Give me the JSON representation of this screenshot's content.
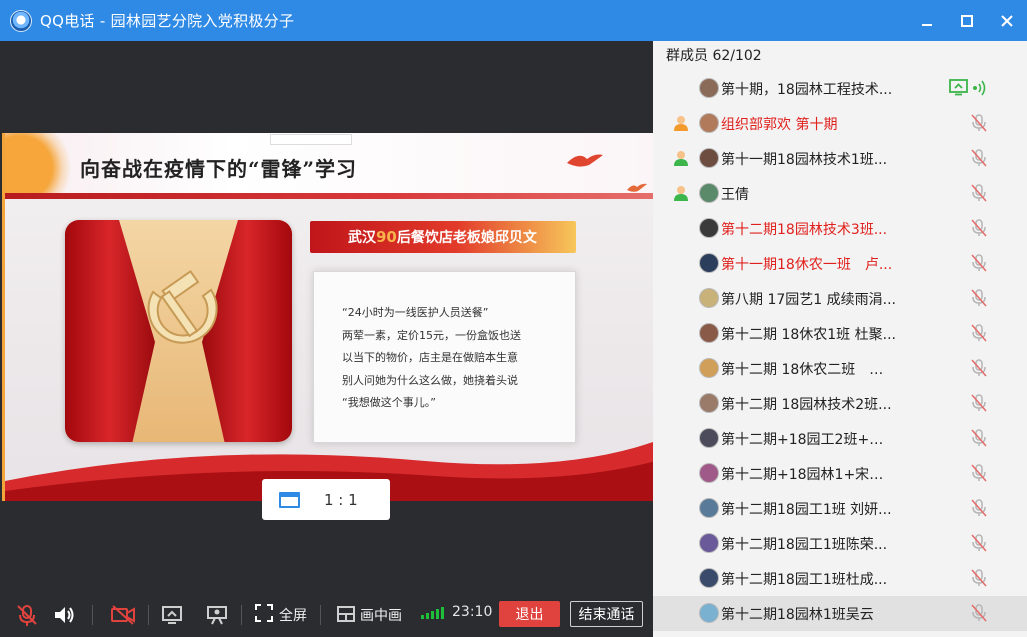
{
  "window": {
    "title": "QQ电话 - 园林园艺分院入党积极分子",
    "controls": [
      "minimize-icon",
      "maximize-icon",
      "close-icon"
    ]
  },
  "slide": {
    "headline": "向奋战在疫情下的“雷锋”学习",
    "banner_prefix": "武汉",
    "banner_num": "90",
    "banner_suffix": "后餐饮店老板娘邱贝文",
    "paragraph_lines": [
      "“24小时为一线医护人员送餐”",
      "两荤一素，定价15元，一份盒饭也送",
      "以当下的物价，店主是在做赔本生意",
      "别人问她为什么这么做，她挠着头说",
      "“我想做这个事儿。”"
    ]
  },
  "ratio": {
    "label": "1 : 1"
  },
  "toolbar": {
    "fullscreen_label": "全屏",
    "pip_label": "画中画",
    "timer": "23:10",
    "exit_label": "退出",
    "end_label": "结束通话"
  },
  "members": {
    "count_label": "群成员 62/102",
    "items": [
      {
        "name": "第十期，18园林工程技术...",
        "red": false,
        "role": "",
        "status": "sharing",
        "avatar": "#8a6b5a"
      },
      {
        "name": "组织部郭欢 第十期",
        "red": true,
        "role": "admin-orange",
        "status": "muted",
        "avatar": "#b07a5b"
      },
      {
        "name": "第十一期18园林技术1班...",
        "red": false,
        "role": "admin-green",
        "status": "muted",
        "avatar": "#6d4d3f"
      },
      {
        "name": "王倩",
        "red": false,
        "role": "admin-green",
        "status": "muted",
        "avatar": "#5b8a6b"
      },
      {
        "name": "第十二期18园林技术3班...",
        "red": true,
        "role": "",
        "status": "muted",
        "avatar": "#3a3a3a"
      },
      {
        "name": "第十一期18休农一班　卢...",
        "red": true,
        "role": "",
        "status": "muted",
        "avatar": "#2b3f5c"
      },
      {
        "name": "第八期 17园艺1 成续雨涓...",
        "red": false,
        "role": "",
        "status": "muted",
        "avatar": "#c8b27a"
      },
      {
        "name": "第十二期 18休农1班 杜聚...",
        "red": false,
        "role": "",
        "status": "muted",
        "avatar": "#8a5a48"
      },
      {
        "name": "第十二期 18休农二班　叶...",
        "red": false,
        "role": "",
        "status": "muted",
        "avatar": "#d0a05a"
      },
      {
        "name": "第十二期 18园林技术2班...",
        "red": false,
        "role": "",
        "status": "muted",
        "avatar": "#9a7b6a"
      },
      {
        "name": "第十二期+18园工2班+王...",
        "red": false,
        "role": "",
        "status": "muted",
        "avatar": "#4b4b5b"
      },
      {
        "name": "第十二期+18园林1+宋玉...",
        "red": false,
        "role": "",
        "status": "muted",
        "avatar": "#a05a8a"
      },
      {
        "name": "第十二期18园工1班 刘妍...",
        "red": false,
        "role": "",
        "status": "muted",
        "avatar": "#5a7a9a"
      },
      {
        "name": "第十二期18园工1班陈荣...",
        "red": false,
        "role": "",
        "status": "muted",
        "avatar": "#6a5a9a"
      },
      {
        "name": "第十二期18园工1班杜成...",
        "red": false,
        "role": "",
        "status": "muted",
        "avatar": "#3a4a6a"
      },
      {
        "name": "第十二期18园林1班吴云",
        "red": false,
        "role": "",
        "status": "muted",
        "avatar": "#7ab0d0",
        "selected": true
      }
    ]
  },
  "colors": {
    "titlebar": "#2f8ae6",
    "red_name": "#e0211d",
    "exit": "#e0433e",
    "signal": "#1fbf3a",
    "sharing": "#3cb54a"
  }
}
